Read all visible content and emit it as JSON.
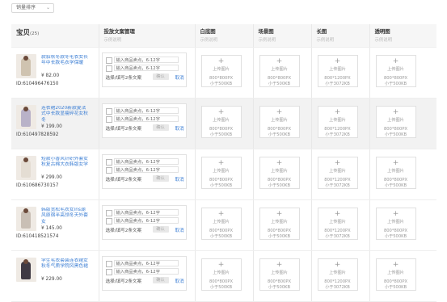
{
  "sort": {
    "label": "销量排序"
  },
  "table": {
    "item_header": "宝贝",
    "item_count": "(25)",
    "columns": [
      {
        "title": "投放文案管理",
        "sub": "示例说明"
      },
      {
        "title": "白底图",
        "sub": "示例说明"
      },
      {
        "title": "场景图",
        "sub": "示例说明"
      },
      {
        "title": "长图",
        "sub": "示例说明"
      },
      {
        "title": "透明图",
        "sub": "示例说明"
      }
    ]
  },
  "copy": {
    "placeholder": "输入商品卖点，6-12字",
    "select_hint": "选择/填写2条文案",
    "ok_label": "确认",
    "cancel_label": "取消"
  },
  "upload": {
    "plus": "+",
    "label": "上传图片",
    "square_dims": "800*800PX",
    "long_dims": "800*1200PX",
    "size_500": "小于500KB",
    "size_3072": "小于3072KB"
  },
  "products": [
    {
      "title": "款貂秋冬款冬毛衣女长年中长款毛衣学保暖",
      "price": "¥ 82.00",
      "id": "ID:610496476150",
      "color": "#cfc3b0"
    },
    {
      "title": "连衣裙2020新款夏法式中长款显瘦碎花女秋冬",
      "price": "¥ 199.00",
      "id": "ID:610497828592",
      "color": "#b9b2c8"
    },
    {
      "title": "短款小香风针织外套女秋复古棉大衣韩版女学",
      "price": "¥ 299.00",
      "id": "ID:610686730157",
      "color": "#e4ddd3"
    },
    {
      "title": "韩版宽松毛衣女ins潮风原宿半高领冬天外套女",
      "price": "¥ 145.00",
      "id": "ID:610418521574",
      "color": "#c9bfb5"
    },
    {
      "title": "学生毛衣套装连衣裙女秋冬气质学院风黑色裙",
      "price": "¥ 229.00",
      "id": "",
      "color": "#3f3a44"
    }
  ]
}
